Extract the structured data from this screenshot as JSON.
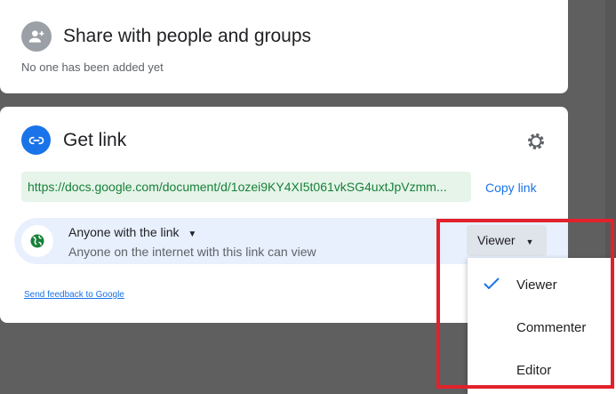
{
  "share": {
    "title": "Share with people and groups",
    "empty": "No one has been added yet"
  },
  "link": {
    "title": "Get link",
    "url": "https://docs.google.com/document/d/1ozei9KY4XI5t061vkSG4uxtJpVzmm...",
    "copy_label": "Copy link",
    "access": {
      "scope": "Anyone with the link",
      "description": "Anyone on the internet with this link can view",
      "role": "Viewer"
    },
    "feedback": "Send feedback to Google"
  },
  "role_menu": {
    "items": [
      {
        "label": "Viewer",
        "selected": true
      },
      {
        "label": "Commenter",
        "selected": false
      },
      {
        "label": "Editor",
        "selected": false
      }
    ]
  },
  "colors": {
    "accent": "#1a73e8",
    "highlight": "#e3212b"
  }
}
